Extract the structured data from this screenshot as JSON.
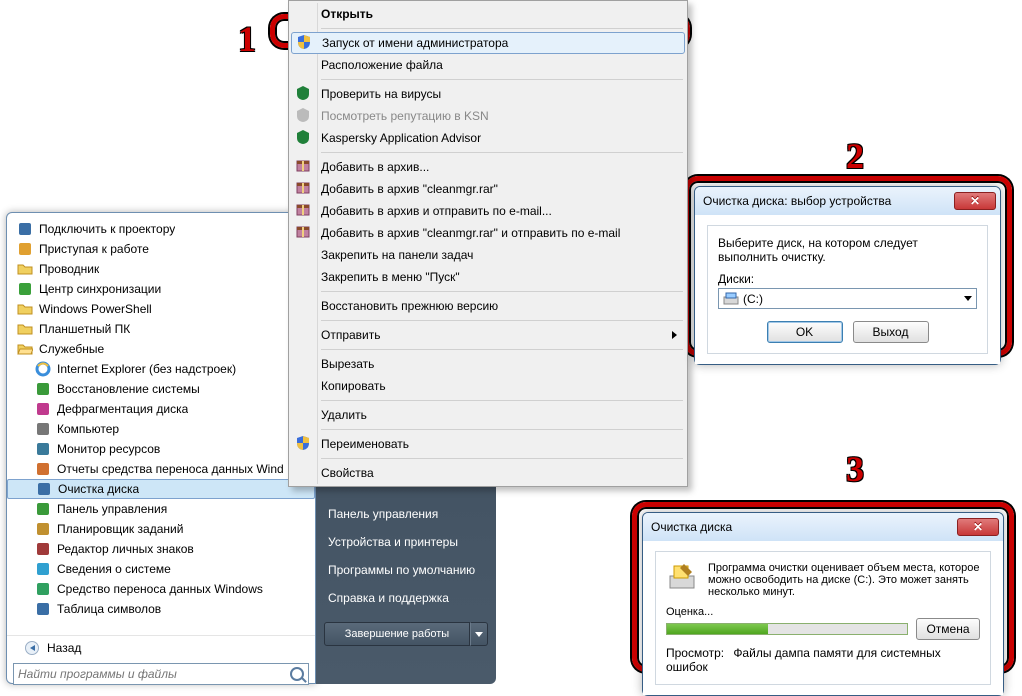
{
  "annotations": {
    "one": "1",
    "two": "2",
    "three": "3"
  },
  "startmenu": {
    "items": [
      {
        "label": "Подключить к проектору",
        "icon": "projector"
      },
      {
        "label": "Приступая к работе",
        "icon": "flag"
      },
      {
        "label": "Проводник",
        "icon": "folder"
      },
      {
        "label": "Центр синхронизации",
        "icon": "sync"
      },
      {
        "label": "Windows PowerShell",
        "icon": "folder-y"
      },
      {
        "label": "Планшетный ПК",
        "icon": "folder-y"
      },
      {
        "label": "Служебные",
        "icon": "folder-open"
      },
      {
        "label": "Internet Explorer (без надстроек)",
        "icon": "ie",
        "indent": true
      },
      {
        "label": "Восстановление системы",
        "icon": "restore",
        "indent": true
      },
      {
        "label": "Дефрагментация диска",
        "icon": "defrag",
        "indent": true
      },
      {
        "label": "Компьютер",
        "icon": "pc",
        "indent": true
      },
      {
        "label": "Монитор ресурсов",
        "icon": "monitor",
        "indent": true
      },
      {
        "label": "Отчеты средства переноса данных Wind",
        "icon": "report",
        "indent": true
      },
      {
        "label": "Очистка диска",
        "icon": "cleanup",
        "indent": true,
        "selected": true
      },
      {
        "label": "Панель управления",
        "icon": "cpanel",
        "indent": true
      },
      {
        "label": "Планировщик заданий",
        "icon": "sched",
        "indent": true
      },
      {
        "label": "Редактор личных знаков",
        "icon": "char",
        "indent": true
      },
      {
        "label": "Сведения о системе",
        "icon": "info",
        "indent": true
      },
      {
        "label": "Средство переноса данных Windows",
        "icon": "transfer",
        "indent": true
      },
      {
        "label": "Таблица символов",
        "icon": "table",
        "indent": true
      }
    ],
    "back": "Назад",
    "search_placeholder": "Найти программы и файлы"
  },
  "rightpanel": {
    "items": [
      "Панель управления",
      "Устройства и принтеры",
      "Программы по умолчанию",
      "Справка и поддержка"
    ],
    "shutdown": "Завершение работы"
  },
  "contextmenu": {
    "groups": [
      [
        {
          "label": "Открыть",
          "bold": true
        }
      ],
      [
        {
          "label": "Запуск от имени администратора",
          "icon": "shield",
          "hl": true
        },
        {
          "label": "Расположение файла"
        }
      ],
      [
        {
          "label": "Проверить на вирусы",
          "icon": "kasp"
        },
        {
          "label": "Посмотреть репутацию в KSN",
          "icon": "kasp-g",
          "dis": true
        },
        {
          "label": "Kaspersky Application Advisor",
          "icon": "kasp"
        }
      ],
      [
        {
          "label": "Добавить в архив...",
          "icon": "rar"
        },
        {
          "label": "Добавить в архив \"cleanmgr.rar\"",
          "icon": "rar"
        },
        {
          "label": "Добавить в архив и отправить по e-mail...",
          "icon": "rar"
        },
        {
          "label": "Добавить в архив \"cleanmgr.rar\" и отправить по e-mail",
          "icon": "rar"
        },
        {
          "label": "Закрепить на панели задач"
        },
        {
          "label": "Закрепить в меню \"Пуск\""
        }
      ],
      [
        {
          "label": "Восстановить прежнюю версию"
        }
      ],
      [
        {
          "label": "Отправить",
          "sub": true
        }
      ],
      [
        {
          "label": "Вырезать"
        },
        {
          "label": "Копировать"
        }
      ],
      [
        {
          "label": "Удалить"
        }
      ],
      [
        {
          "label": "Переименовать",
          "icon": "shield"
        }
      ],
      [
        {
          "label": "Свойства"
        }
      ]
    ]
  },
  "dialog2": {
    "title": "Очистка диска: выбор устройства",
    "text": "Выберите диск, на котором следует выполнить очистку.",
    "label": "Диски:",
    "value": "(C:)",
    "ok": "OK",
    "exit": "Выход"
  },
  "dialog3": {
    "title": "Очистка диска",
    "text": "Программа очистки оценивает объем места, которое можно освободить на диске  (C:). Это может занять несколько минут.",
    "eval": "Оценка...",
    "cancel": "Отмена",
    "view_label": "Просмотр:",
    "view_value": "Файлы дампа памяти для системных ошибок"
  }
}
